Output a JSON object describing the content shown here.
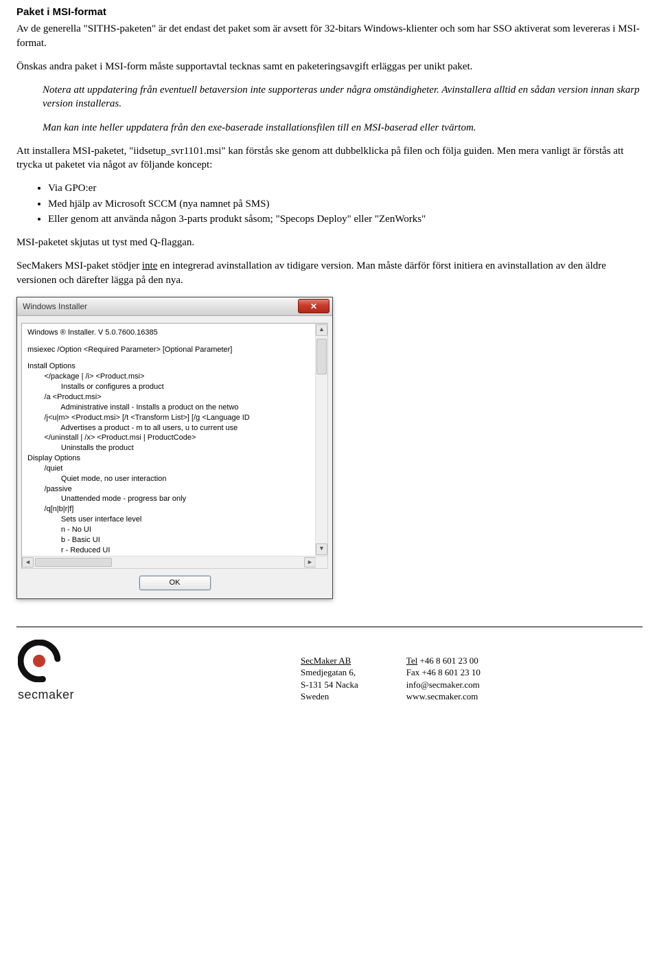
{
  "heading": "Paket i MSI-format",
  "p1": "Av de generella \"SITHS-paketen\" är det endast det paket som är avsett för 32-bitars Windows-klienter och som har SSO aktiverat som levereras i MSI-format.",
  "p2": "Önskas andra paket i MSI-form måste supportavtal tecknas samt en paketeringsavgift erläggas per unikt paket.",
  "note1": "Notera att uppdatering från eventuell betaversion inte supporteras under några omständigheter. Avinstallera alltid en sådan version innan skarp version installeras.",
  "note2": "Man kan inte heller uppdatera från den exe-baserade installationsfilen till en MSI-baserad eller tvärtom.",
  "p3": "Att installera MSI-paketet, \"iidsetup_svr1101.msi\" kan förstås ske genom att dubbelklicka på filen och följa guiden. Men mera vanligt är förstås att trycka ut paketet via något av följande koncept:",
  "bullets": [
    "Via GPO:er",
    "Med hjälp av Microsoft SCCM (nya namnet på SMS)",
    "Eller genom att använda någon 3-parts produkt såsom; \"Specops Deploy\" eller \"ZenWorks\""
  ],
  "p4": "MSI-paketet skjutas ut tyst med Q-flaggan.",
  "p5a": "SecMakers MSI-paket stödjer ",
  "p5_inte": "inte",
  "p5b": " en integrerad avinstallation av tidigare version. Man måste därför först initiera en avinstallation av den äldre versionen och därefter lägga på den nya.",
  "dialog": {
    "title": "Windows Installer",
    "close_glyph": "✕",
    "help": {
      "l0": "Windows ® Installer. V 5.0.7600.16385",
      "l1": "msiexec /Option <Required Parameter> [Optional Parameter]",
      "l2": "Install Options",
      "l3": "        </package | /i> <Product.msi>",
      "l4": "                Installs or configures a product",
      "l5": "        /a <Product.msi>",
      "l6": "                Administrative install - Installs a product on the netwo",
      "l7": "        /j<u|m> <Product.msi> [/t <Transform List>] [/g <Language ID",
      "l8": "                Advertises a product - m to all users, u to current use",
      "l9": "        </uninstall | /x> <Product.msi | ProductCode>",
      "l10": "                Uninstalls the product",
      "l11": "Display Options",
      "l12": "        /quiet",
      "l13": "                Quiet mode, no user interaction",
      "l14": "        /passive",
      "l15": "                Unattended mode - progress bar only",
      "l16": "        /q[n|b|r|f]",
      "l17": "                Sets user interface level",
      "l18": "                n - No UI",
      "l19": "                b - Basic UI",
      "l20": "                r - Reduced UI"
    },
    "ok_label": "OK",
    "scroll_up": "▲",
    "scroll_down": "▼",
    "scroll_left": "◄",
    "scroll_right": "►"
  },
  "footer": {
    "brand": "secmaker",
    "addr": {
      "l1": "SecMaker AB",
      "l2": "Smedjegatan 6,",
      "l3": "S-131 54 Nacka",
      "l4": "Sweden"
    },
    "contact": {
      "l1a": "Tel",
      "l1b": " +46 8 601 23 00",
      "l2a": "Fax",
      "l2b": " +46 8 601 23 10",
      "l3": "info@secmaker.com",
      "l4": "www.secmaker.com"
    }
  }
}
